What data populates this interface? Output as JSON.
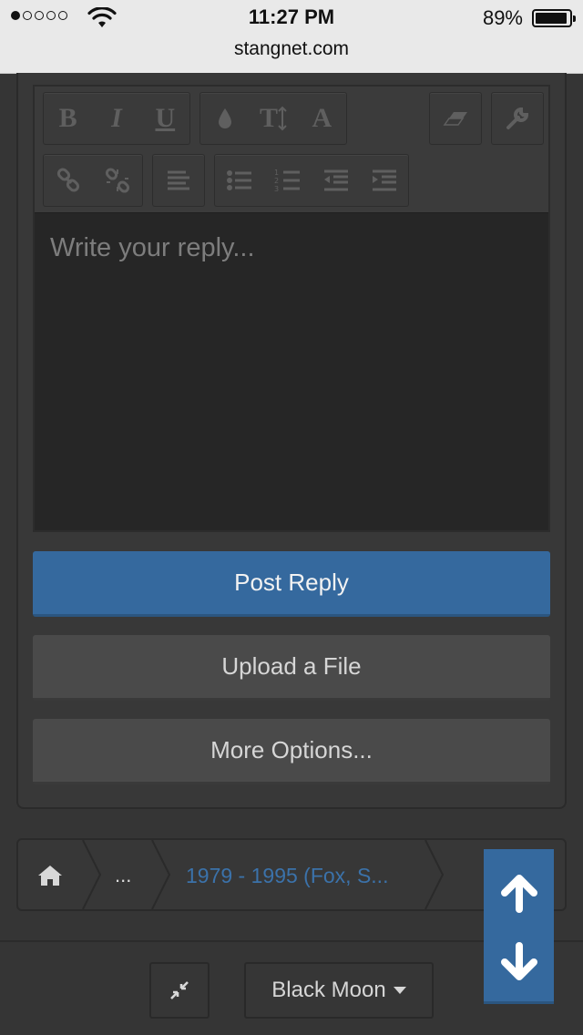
{
  "status_bar": {
    "time": "11:27 PM",
    "battery_percent": "89%",
    "battery_level": 0.89,
    "signal_bars_filled": 1,
    "signal_bars_total": 5
  },
  "browser": {
    "url": "stangnet.com"
  },
  "editor": {
    "toolbar": {
      "bold": "B",
      "italic": "I",
      "underline": "U",
      "font_size": "T",
      "font_family": "A",
      "icons": [
        "text-color-icon",
        "font-size-icon",
        "font-family-icon",
        "eraser-icon",
        "wrench-icon",
        "link-icon",
        "unlink-icon",
        "align-left-icon",
        "bullet-list-icon",
        "numbered-list-icon",
        "outdent-icon",
        "indent-icon"
      ]
    },
    "placeholder": "Write your reply..."
  },
  "buttons": {
    "post_reply": "Post Reply",
    "upload_file": "Upload a File",
    "more_options": "More Options..."
  },
  "breadcrumb": {
    "ellipsis": "...",
    "forum": "1979 - 1995 (Fox, S..."
  },
  "footer": {
    "style_chooser": "Black Moon"
  },
  "colors": {
    "accent": "#35699e",
    "link": "#3b72aa",
    "background": "#353535",
    "textarea": "#262626"
  }
}
